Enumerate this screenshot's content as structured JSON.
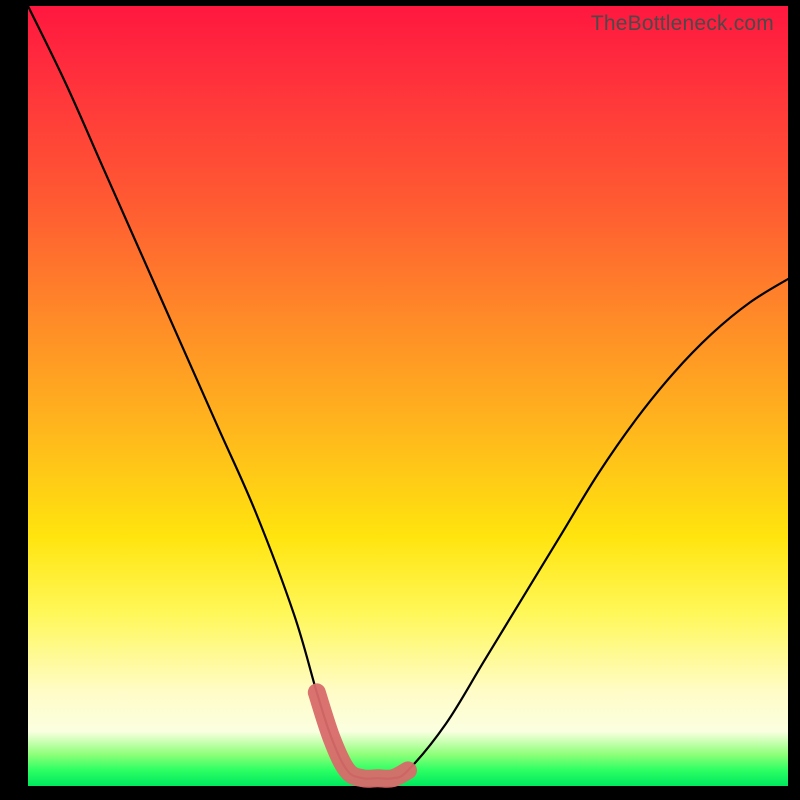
{
  "watermark": "TheBottleneck.com",
  "chart_data": {
    "type": "line",
    "title": "",
    "xlabel": "",
    "ylabel": "",
    "xlim": [
      0,
      100
    ],
    "ylim": [
      0,
      100
    ],
    "series": [
      {
        "name": "bottleneck-curve",
        "x": [
          0,
          5,
          10,
          15,
          20,
          25,
          30,
          35,
          38,
          40,
          42,
          44,
          46,
          48,
          50,
          55,
          60,
          65,
          70,
          75,
          80,
          85,
          90,
          95,
          100
        ],
        "values": [
          100,
          90,
          79,
          68,
          57,
          46,
          35,
          22,
          12,
          6,
          2,
          1,
          1,
          1,
          2,
          8,
          16,
          24,
          32,
          40,
          47,
          53,
          58,
          62,
          65
        ]
      }
    ],
    "highlight": {
      "name": "optimum-region",
      "x_start": 38,
      "x_end": 50,
      "color": "#d86a6a"
    },
    "gradient_stops": [
      {
        "pos": 0,
        "color": "#ff173f"
      },
      {
        "pos": 25,
        "color": "#ff5a32"
      },
      {
        "pos": 55,
        "color": "#ffb91c"
      },
      {
        "pos": 78,
        "color": "#fff85a"
      },
      {
        "pos": 93,
        "color": "#fbffe0"
      },
      {
        "pos": 100,
        "color": "#00e85e"
      }
    ]
  }
}
